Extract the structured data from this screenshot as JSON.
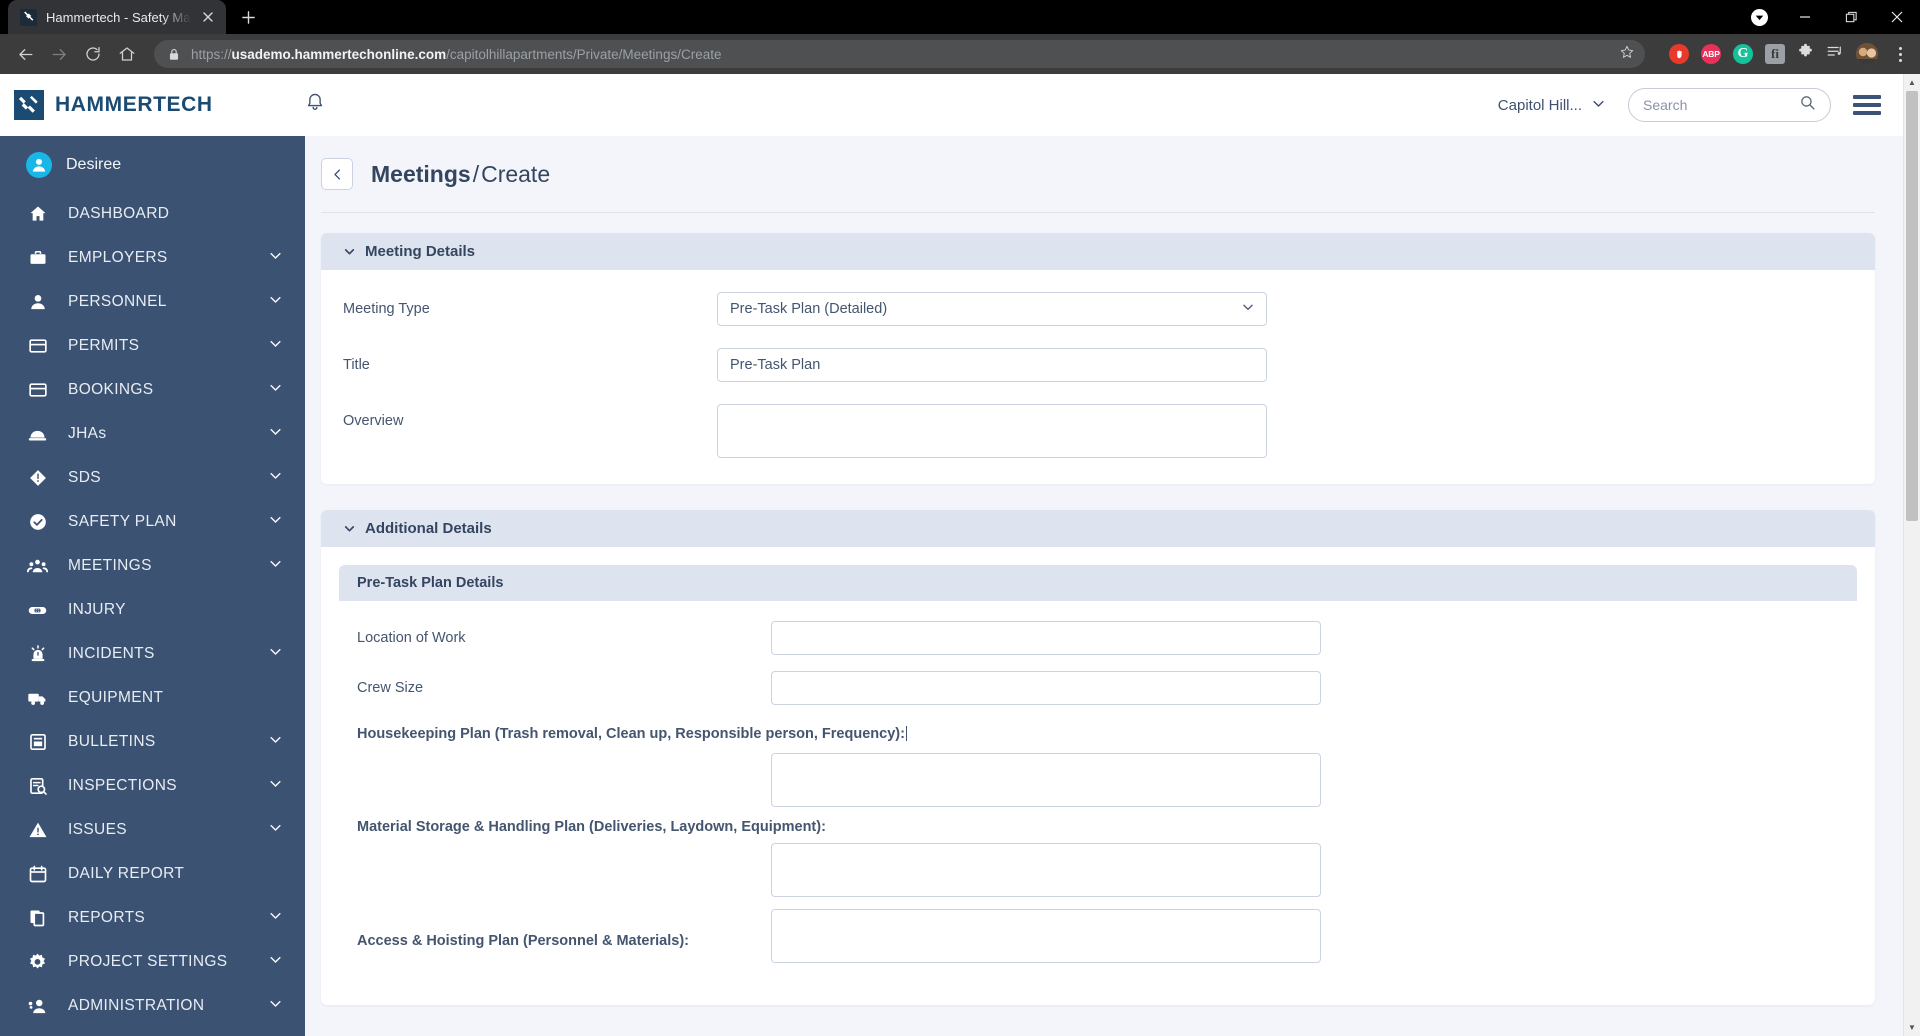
{
  "browser": {
    "tab": {
      "title": "Hammertech - Safety Manageme",
      "favicon": "hammertech-favicon"
    },
    "new_tab_label": "+",
    "url": {
      "scheme": "https://",
      "domain": "usademo.hammertechonline.com",
      "path": "/capitolhillapartments/Private/Meetings/Create"
    },
    "extensions": [
      "hand-icon",
      "abp-icon",
      "grammarly-icon",
      "script-icon",
      "puzzle-icon",
      "playlist-icon",
      "profile-avatar"
    ],
    "abp_label": "ABP",
    "grammarly_label": "G",
    "script_label": "fi",
    "window_controls": [
      "download-icon",
      "minimize-icon",
      "maximize-icon",
      "close-icon"
    ]
  },
  "header": {
    "brand": "HAMMERTECH",
    "project": "Capitol Hill...",
    "search": {
      "placeholder": "Search",
      "value": ""
    }
  },
  "sidebar": {
    "user": "Desiree",
    "items": [
      {
        "label": "DASHBOARD",
        "icon": "home-icon",
        "expandable": false
      },
      {
        "label": "EMPLOYERS",
        "icon": "briefcase-icon",
        "expandable": true
      },
      {
        "label": "PERSONNEL",
        "icon": "person-icon",
        "expandable": true
      },
      {
        "label": "PERMITS",
        "icon": "card-icon",
        "expandable": true
      },
      {
        "label": "BOOKINGS",
        "icon": "card-icon",
        "expandable": true
      },
      {
        "label": "JHAs",
        "icon": "hardhat-icon",
        "expandable": true
      },
      {
        "label": "SDS",
        "icon": "diamond-warning-icon",
        "expandable": true
      },
      {
        "label": "SAFETY PLAN",
        "icon": "check-circle-icon",
        "expandable": true
      },
      {
        "label": "MEETINGS",
        "icon": "people-group-icon",
        "expandable": true
      },
      {
        "label": "INJURY",
        "icon": "bandage-icon",
        "expandable": false
      },
      {
        "label": "INCIDENTS",
        "icon": "siren-icon",
        "expandable": true
      },
      {
        "label": "EQUIPMENT",
        "icon": "truck-icon",
        "expandable": false
      },
      {
        "label": "BULLETINS",
        "icon": "bulletin-board-icon",
        "expandable": true
      },
      {
        "label": "INSPECTIONS",
        "icon": "clipboard-search-icon",
        "expandable": true
      },
      {
        "label": "ISSUES",
        "icon": "warning-triangle-icon",
        "expandable": true
      },
      {
        "label": "DAILY REPORT",
        "icon": "calendar-icon",
        "expandable": false
      },
      {
        "label": "REPORTS",
        "icon": "documents-icon",
        "expandable": true
      },
      {
        "label": "PROJECT SETTINGS",
        "icon": "gear-icon",
        "expandable": true
      },
      {
        "label": "ADMINISTRATION",
        "icon": "user-settings-icon",
        "expandable": true
      }
    ]
  },
  "page": {
    "title_main": "Meetings",
    "title_sep": "/",
    "title_sub": "Create"
  },
  "meeting_details": {
    "section_title": "Meeting Details",
    "meeting_type_label": "Meeting Type",
    "meeting_type_value": "Pre-Task Plan (Detailed)",
    "title_label": "Title",
    "title_value": "Pre-Task Plan",
    "overview_label": "Overview",
    "overview_value": ""
  },
  "additional_details": {
    "section_title": "Additional Details",
    "subsection_title": "Pre-Task Plan Details",
    "location_label": "Location of Work",
    "location_value": "",
    "crew_label": "Crew Size",
    "crew_value": "",
    "housekeeping_label": "Housekeeping Plan (Trash removal, Clean up, Responsible person, Frequency):",
    "housekeeping_value": "",
    "material_label": "Material Storage & Handling Plan (Deliveries, Laydown, Equipment):",
    "material_value": "",
    "access_label": "Access & Hoisting Plan (Personnel & Materials):",
    "access_value": ""
  },
  "colors": {
    "sidebar_bg": "#3b5272",
    "brand_blue": "#1b4a73",
    "accent_cyan": "#19b6e8",
    "section_bar": "#dde3ef",
    "page_bg": "#f3f5fb",
    "text_body": "#44556f"
  }
}
